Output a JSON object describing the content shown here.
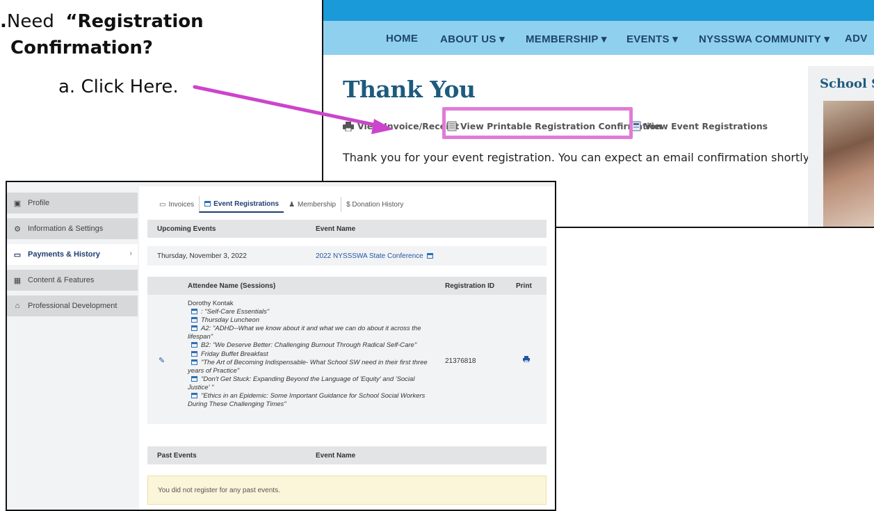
{
  "instruction": {
    "line1_prefix": "Need",
    "line1_bold": "“Registration",
    "line2": "Confirmation?",
    "line3": "a.  Click Here.",
    "highlight_color": "#e07bd8",
    "arrow_color": "#cc44cc"
  },
  "site": {
    "nav": [
      "HOME",
      "ABOUT US ▾",
      "MEMBERSHIP ▾",
      "EVENTS ▾",
      "NYSSSWA COMMUNITY ▾",
      "ADV"
    ],
    "title": "Thank You",
    "links": {
      "invoice": "View Invoice/Receipt",
      "printable": "View Printable Registration Confirmation",
      "event_regs": "View Event Registrations"
    },
    "message": "Thank you for your event registration. You can expect an email confirmation shortly.",
    "sidebar_title": "School S",
    "colors": {
      "top_band": "#1a9ad8",
      "nav_bg": "#8fd0ee",
      "title": "#1d5b7e"
    }
  },
  "account": {
    "sidebar": [
      {
        "icon": "profile-icon",
        "label": "Profile"
      },
      {
        "icon": "gears-icon",
        "label": "Information & Settings"
      },
      {
        "icon": "money-icon",
        "label": "Payments & History",
        "active": true
      },
      {
        "icon": "table-icon",
        "label": "Content & Features"
      },
      {
        "icon": "graduation-cap-icon",
        "label": "Professional Development"
      }
    ],
    "tabs": [
      {
        "icon": "invoice-icon",
        "label": "Invoices"
      },
      {
        "icon": "calendar-icon",
        "label": "Event Registrations",
        "active": true
      },
      {
        "icon": "user-icon",
        "label": "Membership"
      },
      {
        "icon": "dollar-icon",
        "label": "$ Donation History"
      }
    ],
    "upcoming": {
      "col1": "Upcoming Events",
      "col2": "Event Name",
      "date": "Thursday, November 3, 2022",
      "event": "2022 NYSSSWA State Conference"
    },
    "attendee_table": {
      "col_name": "Attendee Name (Sessions)",
      "col_reg": "Registration ID",
      "col_print": "Print",
      "name": "Dorothy Kontak",
      "registration_id": "21376818",
      "sessions": [
        ": \"Self-Care Essentials\"",
        "Thursday Luncheon",
        "A2: \"ADHD--What we know about it and what we can do about it across the lifespan\"",
        "B2: \"We Deserve Better: Challenging Burnout Through Radical Self-Care\"",
        "Friday Buffet Breakfast",
        "\"The Art of Becoming Indispensable- What School SW need in their first three years of Practice\"",
        "\"Don't Get Stuck: Expanding Beyond the Language of 'Equity' and 'Social Justice' \"",
        "\"Ethics in an Epidemic: Some Important Guidance for School Social Workers During These Challenging Times\""
      ]
    },
    "past": {
      "col1": "Past Events",
      "col2": "Event Name",
      "message": "You did not register for any past events."
    }
  }
}
